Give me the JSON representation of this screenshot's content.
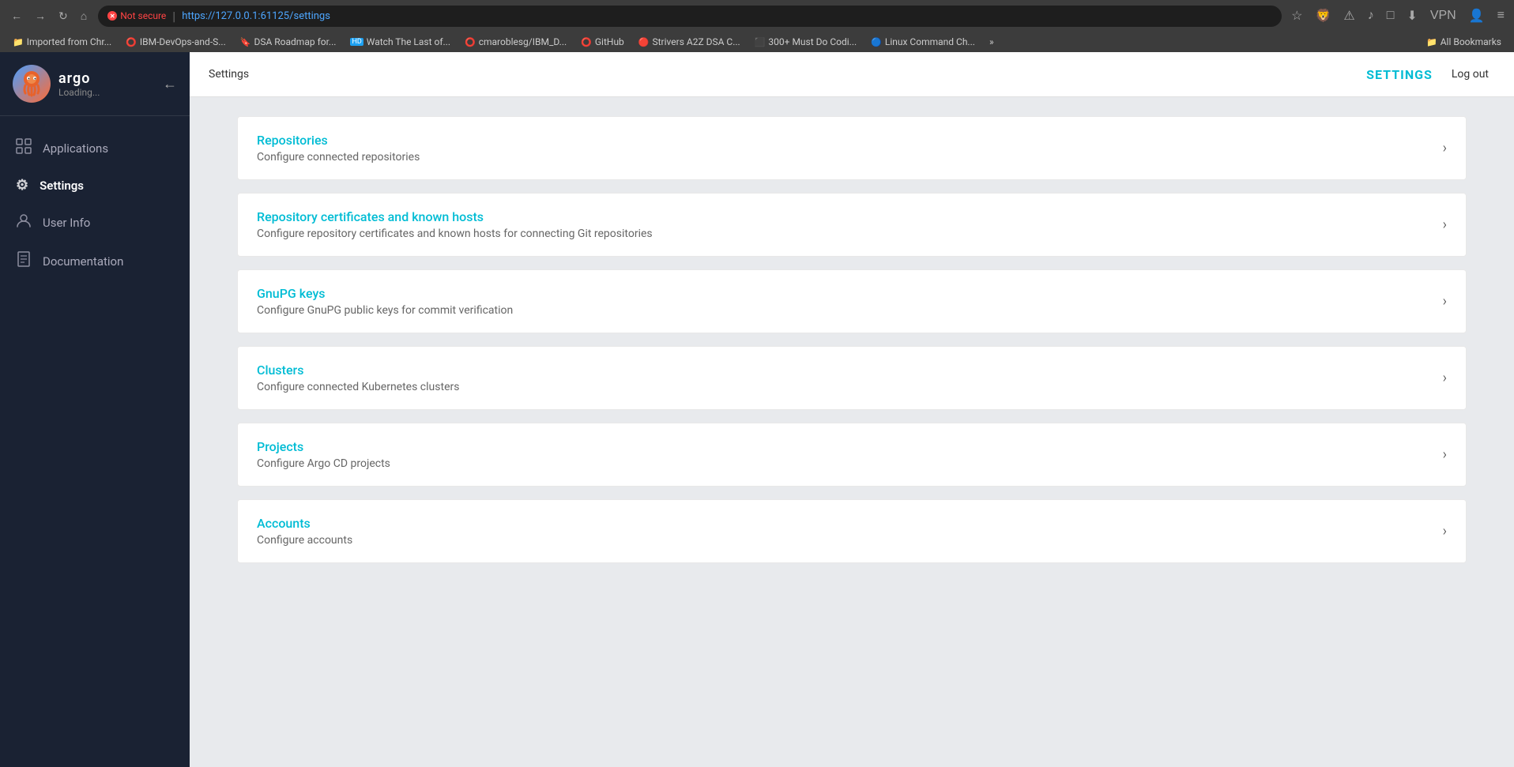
{
  "browser": {
    "not_secure_label": "Not secure",
    "url": "https://127.0.0.1:61125/settings",
    "bookmarks": [
      {
        "icon": "📁",
        "label": "Imported from Chr..."
      },
      {
        "icon": "⭕",
        "label": "IBM-DevOps-and-S..."
      },
      {
        "icon": "🔖",
        "label": "DSA Roadmap for..."
      },
      {
        "icon": "📺",
        "label": "Watch The Last of..."
      },
      {
        "icon": "⭕",
        "label": "cmaroblesg/IBM_D..."
      },
      {
        "icon": "⭕",
        "label": "GitHub"
      },
      {
        "icon": "🔴",
        "label": "Strivers A2Z DSA C..."
      },
      {
        "icon": "⬛",
        "label": "300+ Must Do Codi..."
      },
      {
        "icon": "🔵",
        "label": "Linux Command Ch..."
      },
      {
        "icon": "»",
        "label": ""
      },
      {
        "icon": "📁",
        "label": "All Bookmarks"
      }
    ]
  },
  "sidebar": {
    "logo_name": "argo",
    "logo_status": "Loading...",
    "nav_items": [
      {
        "label": "Applications",
        "icon": "⊞",
        "active": false
      },
      {
        "label": "Settings",
        "icon": "⚙",
        "active": true
      },
      {
        "label": "User Info",
        "icon": "👤",
        "active": false
      },
      {
        "label": "Documentation",
        "icon": "📋",
        "active": false
      }
    ]
  },
  "header": {
    "title": "Settings",
    "settings_label": "SETTINGS",
    "logout_label": "Log out"
  },
  "settings_cards": [
    {
      "title": "Repositories",
      "description": "Configure connected repositories"
    },
    {
      "title": "Repository certificates and known hosts",
      "description": "Configure repository certificates and known hosts for connecting Git repositories"
    },
    {
      "title": "GnuPG keys",
      "description": "Configure GnuPG public keys for commit verification"
    },
    {
      "title": "Clusters",
      "description": "Configure connected Kubernetes clusters"
    },
    {
      "title": "Projects",
      "description": "Configure Argo CD projects"
    },
    {
      "title": "Accounts",
      "description": "Configure accounts"
    }
  ]
}
